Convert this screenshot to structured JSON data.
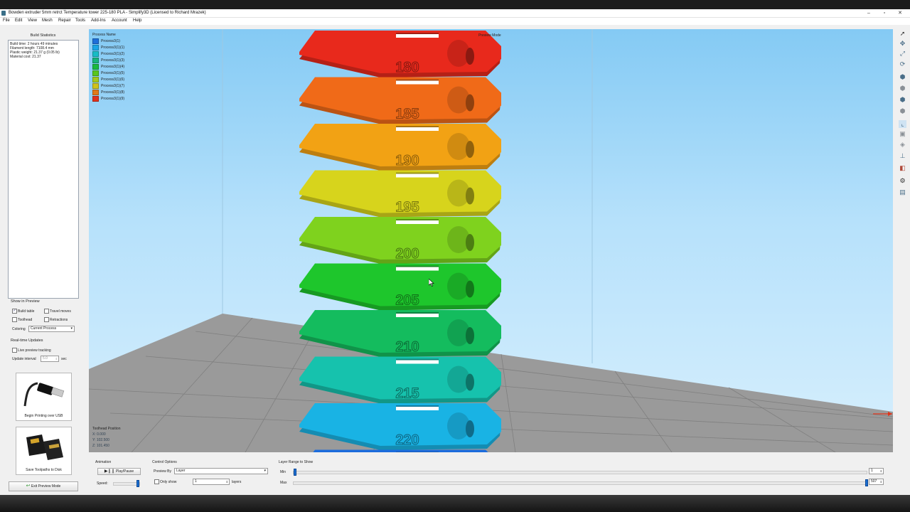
{
  "window": {
    "title": "Bowden extruder 5mm retrct Temperature tower 225-180 PLA - Simplify3D (Licensed to Richard Mrazek)",
    "controls": {
      "minimize": "–",
      "maximize": "▫",
      "close": "✕"
    }
  },
  "menu": [
    "File",
    "Edit",
    "View",
    "Mesh",
    "Repair",
    "Tools",
    "Add-Ins",
    "Account",
    "Help"
  ],
  "build_statistics": {
    "title": "Build Statistics",
    "lines": [
      "Build time: 2 hours 49 minutes",
      "Filament length: 7108.4 mm",
      "Plastic weight: 21.37 g (0.05 lb)",
      "Material cost: 21.37"
    ]
  },
  "show_in_preview": {
    "title": "Show in Preview",
    "build_table": {
      "label": "Build table",
      "checked": true
    },
    "travel_moves": {
      "label": "Travel moves",
      "checked": false
    },
    "toolhead": {
      "label": "Toolhead",
      "checked": false
    },
    "retractions": {
      "label": "Retractions",
      "checked": false
    },
    "coloring_label": "Coloring",
    "coloring_value": "Current Process"
  },
  "realtime": {
    "title": "Real-time Updates",
    "live_preview": {
      "label": "Live preview tracking",
      "checked": false
    },
    "update_interval_label": "Update interval",
    "update_interval_value": "5.0",
    "unit": "sec"
  },
  "usb_card": {
    "label": "Begin Printing over USB"
  },
  "sd_card": {
    "label": "Save Toolpaths to Disk"
  },
  "exit_button": {
    "label": "Exit Preview Mode"
  },
  "legend": {
    "title": "Process Name",
    "items": [
      {
        "name": "Process3(1)",
        "color": "#1e6fd9"
      },
      {
        "name": "Process3(1)(1)",
        "color": "#1aa5e6"
      },
      {
        "name": "Process3(1)(2)",
        "color": "#18bcc6"
      },
      {
        "name": "Process3(1)(3)",
        "color": "#16b37c"
      },
      {
        "name": "Process3(1)(4)",
        "color": "#19b93f"
      },
      {
        "name": "Process3(1)(5)",
        "color": "#58c61e"
      },
      {
        "name": "Process3(1)(6)",
        "color": "#a3c81e"
      },
      {
        "name": "Process3(1)(7)",
        "color": "#cfc21b"
      },
      {
        "name": "Process3(1)(8)",
        "color": "#e07a19"
      },
      {
        "name": "Process3(1)(9)",
        "color": "#e0311b"
      }
    ]
  },
  "preview_mode": "Preview Mode",
  "toolhead_position": {
    "title": "Toolhead Position",
    "x": "X: 0.000",
    "y": "Y: 102.500",
    "z": "Z: 101.450"
  },
  "tower": {
    "floors": [
      {
        "label": "180",
        "color": "#e8291c"
      },
      {
        "label": "185",
        "color": "#f06a18"
      },
      {
        "label": "190",
        "color": "#f2a214"
      },
      {
        "label": "195",
        "color": "#d7d41c"
      },
      {
        "label": "200",
        "color": "#7fd21e"
      },
      {
        "label": "205",
        "color": "#1ec62c"
      },
      {
        "label": "210",
        "color": "#14bc5e"
      },
      {
        "label": "215",
        "color": "#16c2ad"
      },
      {
        "label": "220",
        "color": "#19b3e4"
      },
      {
        "label": "",
        "color": "#1c6cdc"
      }
    ]
  },
  "animation": {
    "title": "Animation",
    "play_pause": "Play/Pause",
    "speed_label": "Speed:",
    "speed_value": 0.95
  },
  "control_options": {
    "title": "Control Options",
    "preview_by_label": "Preview By",
    "preview_by_value": "Layer",
    "only_show_label": "Only show",
    "only_show_checked": false,
    "only_show_value": "1",
    "layers_label": "layers"
  },
  "layer_range": {
    "title": "Layer Range to Show",
    "min_label": "Min",
    "max_label": "Max",
    "min_value": "1",
    "max_value": "507",
    "min_fraction": 0.0,
    "max_fraction": 1.0
  },
  "toolbar_icons": [
    "cursor-icon",
    "move-icon",
    "scale-icon",
    "rotate-icon",
    "view-top-icon",
    "view-front-icon",
    "view-left-icon",
    "view-right-icon",
    "axis-icon",
    "cube-icon",
    "toolhead-icon",
    "ruler-icon",
    "section-icon",
    "gear-icon",
    "machine-icon"
  ]
}
